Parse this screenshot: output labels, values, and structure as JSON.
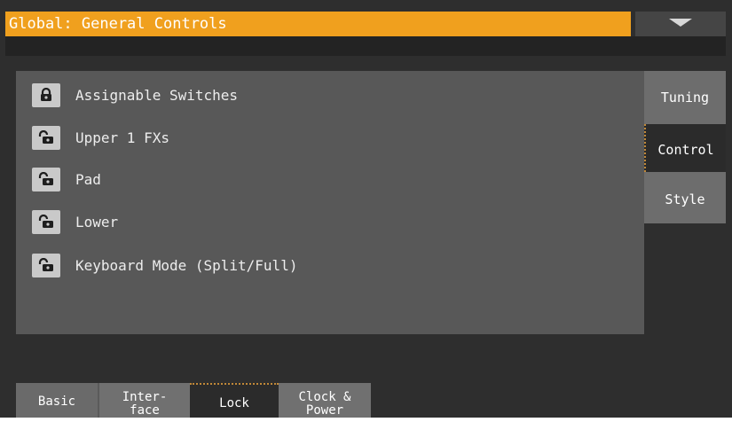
{
  "header": {
    "title": "Global: General Controls",
    "menu_icon": "chevron-down-icon"
  },
  "lock_list": {
    "items": [
      {
        "label": "Assignable Switches",
        "locked": true
      },
      {
        "label": "Upper 1 FXs",
        "locked": false
      },
      {
        "label": "Pad",
        "locked": false
      },
      {
        "label": "Lower",
        "locked": false
      },
      {
        "label": "Keyboard Mode (Split/Full)",
        "locked": false
      }
    ]
  },
  "side_tabs": [
    {
      "label": "Tuning",
      "selected": false
    },
    {
      "label": "Control",
      "selected": true
    },
    {
      "label": "Style",
      "selected": false
    }
  ],
  "bottom_tabs": [
    {
      "label": "Basic",
      "selected": false
    },
    {
      "label_line1": "Inter-",
      "label_line2": "face",
      "selected": false
    },
    {
      "label": "Lock",
      "selected": true
    },
    {
      "label_line1": "Clock &",
      "label_line2": "Power",
      "selected": false
    }
  ],
  "colors": {
    "title_bar": "#f0a01e",
    "screen_background": "#2e2e2e",
    "panel": "#585858",
    "selected_indicator": "#c08838"
  }
}
